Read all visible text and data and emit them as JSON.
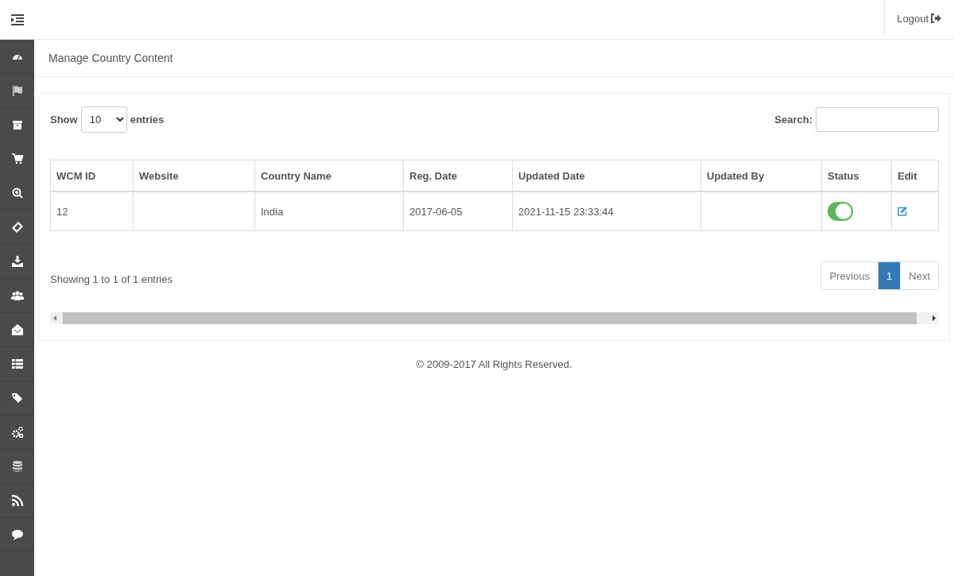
{
  "header": {
    "logout": "Logout"
  },
  "page_title": "Manage Country Content",
  "length_menu": {
    "label_before": "Show",
    "value": "10",
    "label_after": "entries"
  },
  "search": {
    "label": "Search:"
  },
  "table": {
    "columns": [
      "WCM ID",
      "Website",
      "Country Name",
      "Reg. Date",
      "Updated Date",
      "Updated By",
      "Status",
      "Edit"
    ],
    "rows": [
      {
        "cells": [
          "12",
          "",
          "India",
          "2017-06-05",
          "2021-11-15 23:33:44",
          ""
        ],
        "status": true
      }
    ]
  },
  "info": "Showing 1 to 1 of 1 entries",
  "pagination": {
    "previous": "Previous",
    "pages": [
      {
        "label": "1",
        "selected": true
      }
    ],
    "next": "Next"
  },
  "footer": "© 2009-2017 All Rights Reserved."
}
